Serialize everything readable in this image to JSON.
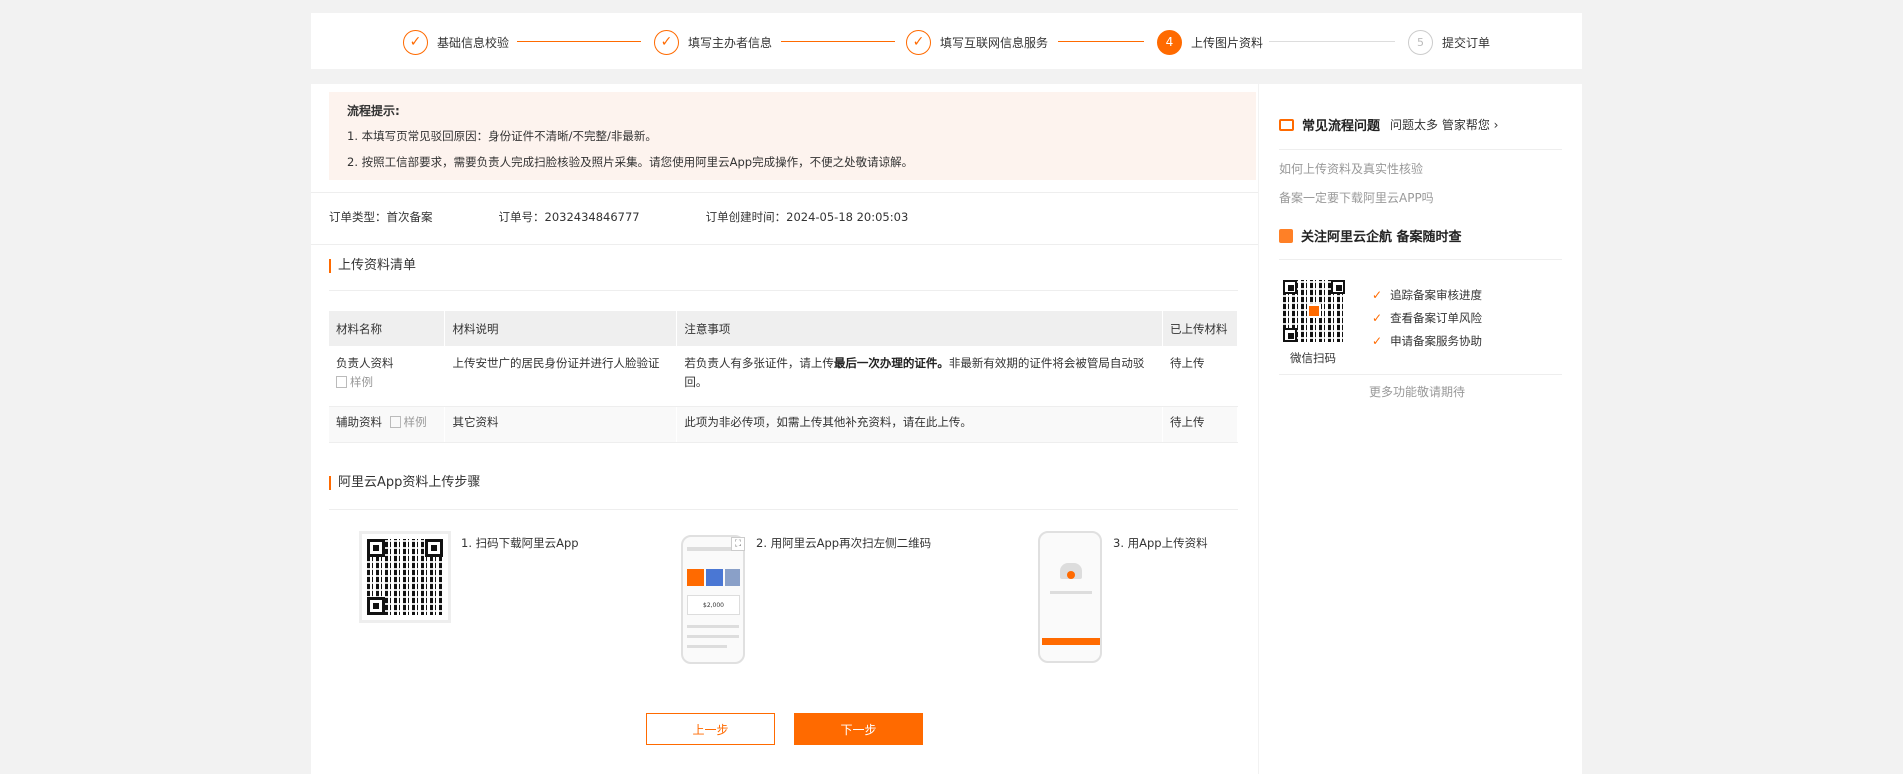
{
  "stepper": {
    "steps": [
      {
        "label": "基础信息校验",
        "state": "done"
      },
      {
        "label": "填写主办者信息",
        "state": "done"
      },
      {
        "label": "填写互联网信息服务",
        "state": "done"
      },
      {
        "label": "上传图片资料",
        "state": "active",
        "num": "4"
      },
      {
        "label": "提交订单",
        "state": "todo",
        "num": "5"
      }
    ]
  },
  "tips": {
    "title": "流程提示:",
    "line1": "1. 本填写页常见驳回原因：身份证件不清晰/不完整/非最新。",
    "line2": "2. 按照工信部要求，需要负责人完成扫脸核验及照片采集。请您使用阿里云App完成操作，不便之处敬请谅解。"
  },
  "order": {
    "type": "订单类型：首次备案",
    "number": "订单号：2032434846777",
    "created": "订单创建时间：2024-05-18 20:05:03"
  },
  "upload_list": {
    "title": "上传资料清单",
    "headers": [
      "材料名称",
      "材料说明",
      "注意事项",
      "已上传材料"
    ],
    "rows": [
      {
        "name": "负责人资料",
        "sample": "样例",
        "desc": "上传安世广的居民身份证并进行人脸验证",
        "note_pre": "若负责人有多张证件，请上传",
        "note_bold": "最后一次办理的证件。",
        "note_post": "非最新有效期的证件将会被管局自动驳回。",
        "status": "待上传"
      },
      {
        "name": "辅助资料",
        "sample": "样例",
        "desc": "其它资料",
        "note_pre": "此项为非必传项，如需上传其他补充资料，请在此上传。",
        "status": "待上传"
      }
    ]
  },
  "app_steps": {
    "title": "阿里云App资料上传步骤",
    "step1": "1. 扫码下载阿里云App",
    "step2": "2. 用阿里云App再次扫左侧二维码",
    "step3": "3. 用App上传资料",
    "phone2_amount": "$2,000"
  },
  "buttons": {
    "prev": "上一步",
    "next": "下一步"
  },
  "sidebar": {
    "faq_title": "常见流程问题",
    "faq_sub": "问题太多 管家帮您",
    "link1": "如何上传资料及真实性核验",
    "link2": "备案一定要下载阿里云APP吗",
    "follow_title": "关注阿里云企航 备案随时查",
    "wechat_label": "微信扫码",
    "features": [
      "追踪备案审核进度",
      "查看备案订单风险",
      "申请备案服务协助"
    ],
    "more": "更多功能敬请期待"
  },
  "colors": {
    "accent": "#ff6a00",
    "tips_bg": "#fdf3ee"
  }
}
